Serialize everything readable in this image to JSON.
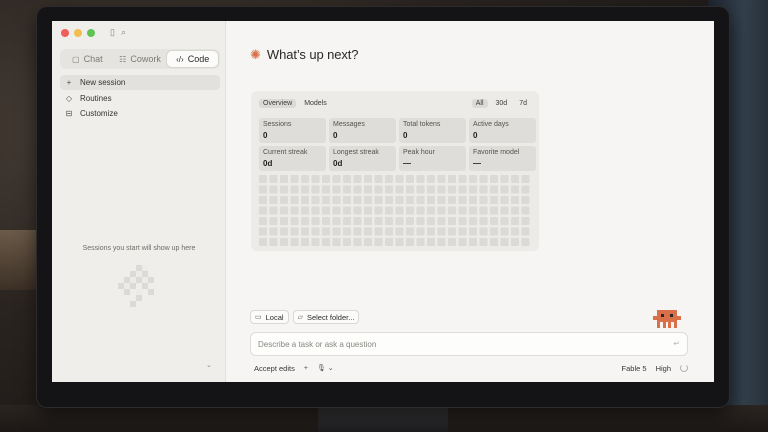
{
  "sidebar": {
    "mode_tabs": [
      {
        "label": "Chat",
        "icon": "chat-bubble-icon",
        "active": false
      },
      {
        "label": "Cowork",
        "icon": "cowork-icon",
        "active": false
      },
      {
        "label": "Code",
        "icon": "code-brackets-icon",
        "active": true
      }
    ],
    "nav": [
      {
        "label": "New session",
        "icon": "plus-icon",
        "glyph": "+"
      },
      {
        "label": "Routines",
        "icon": "routines-icon",
        "glyph": "◇"
      },
      {
        "label": "Customize",
        "icon": "customize-icon",
        "glyph": "⊟"
      }
    ],
    "empty_message": "Sessions you start will show up here"
  },
  "main": {
    "title": "What’s up next?",
    "stats": {
      "tabs": [
        "Overview",
        "Models"
      ],
      "ranges": [
        "All",
        "30d",
        "7d"
      ],
      "cards": [
        {
          "label": "Sessions",
          "value": "0"
        },
        {
          "label": "Messages",
          "value": "0"
        },
        {
          "label": "Total tokens",
          "value": "0"
        },
        {
          "label": "Active days",
          "value": "0"
        },
        {
          "label": "Current streak",
          "value": "0d"
        },
        {
          "label": "Longest streak",
          "value": "0d"
        },
        {
          "label": "Peak hour",
          "value": "—"
        },
        {
          "label": "Favorite model",
          "value": "—"
        }
      ]
    },
    "composer": {
      "local_label": "Local",
      "folder_label": "Select folder...",
      "placeholder": "Describe a task or ask a question"
    },
    "bottom": {
      "accept_edits": "Accept edits",
      "model": "Fable 5",
      "effort": "High"
    }
  },
  "colors": {
    "accent": "#d9704a",
    "mascot": "#d9704a",
    "background": "#f6f5f3",
    "sidebar": "#efeeeb"
  }
}
